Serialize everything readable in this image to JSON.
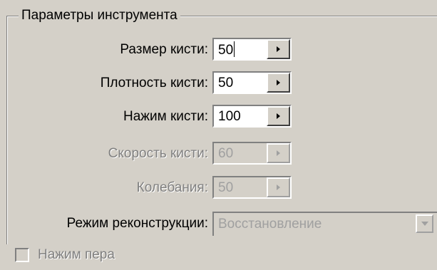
{
  "group": {
    "title": "Параметры инструмента"
  },
  "brush_size": {
    "label": "Размер кисти:",
    "value": "50",
    "enabled": true,
    "focused": true
  },
  "brush_density": {
    "label": "Плотность кисти:",
    "value": "50",
    "enabled": true
  },
  "brush_pressure": {
    "label": "Нажим кисти:",
    "value": "100",
    "enabled": true
  },
  "brush_speed": {
    "label": "Скорость кисти:",
    "value": "60",
    "enabled": false
  },
  "jitter": {
    "label": "Колебания:",
    "value": "50",
    "enabled": false
  },
  "reconstruction_mode": {
    "label": "Режим реконструкции:",
    "value": "Восстановление",
    "enabled": false
  },
  "pen_pressure": {
    "label": "Нажим пера",
    "checked": false,
    "enabled": false
  },
  "icons": {
    "spin_arrow": "arrow-right-icon",
    "dropdown_arrow": "chevron-down-icon",
    "checkbox": "checkbox-icon"
  },
  "colors": {
    "background": "#d4d0c8",
    "disabled_text": "#a0a0a0",
    "shadow": "#808080",
    "highlight": "#ffffff"
  }
}
